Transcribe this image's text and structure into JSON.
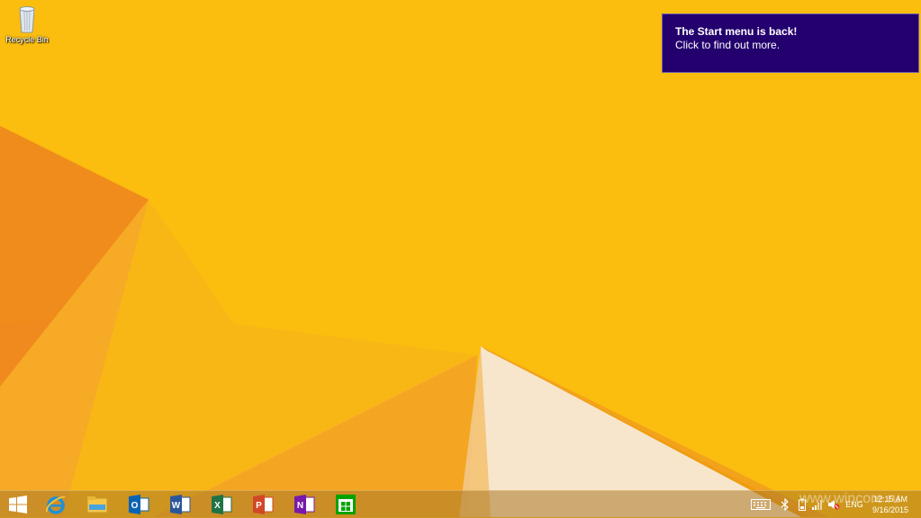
{
  "desktop": {
    "icons": [
      {
        "label": "Recycle Bin",
        "icon": "recycle-bin-icon"
      }
    ]
  },
  "notification": {
    "title": "The Start menu is back!",
    "body": "Click to find out more.",
    "background": "#23006e"
  },
  "taskbar": {
    "start": {
      "icon": "windows-logo-icon"
    },
    "pinned": [
      {
        "name": "Internet Explorer",
        "icon": "internet-explorer-icon",
        "color": "#1e90d6"
      },
      {
        "name": "File Explorer",
        "icon": "file-explorer-icon",
        "color": "#f4c64a"
      },
      {
        "name": "Outlook",
        "icon": "outlook-icon",
        "color": "#0a64b4",
        "letter": "O"
      },
      {
        "name": "Word",
        "icon": "word-icon",
        "color": "#2b579a",
        "letter": "W"
      },
      {
        "name": "Excel",
        "icon": "excel-icon",
        "color": "#217346",
        "letter": "X"
      },
      {
        "name": "PowerPoint",
        "icon": "powerpoint-icon",
        "color": "#d24726",
        "letter": "P"
      },
      {
        "name": "OneNote",
        "icon": "onenote-icon",
        "color": "#7719aa",
        "letter": "N"
      },
      {
        "name": "Store",
        "icon": "store-icon",
        "color": "#00a300"
      }
    ],
    "tray": {
      "icons": [
        "keyboard-icon",
        "bluetooth-icon",
        "battery-icon",
        "signal-icon",
        "volume-muted-icon"
      ],
      "language": "ENG",
      "time": "12:15 AM",
      "date": "9/16/2015"
    }
  },
  "watermark": "www.wincore.ru",
  "colors": {
    "wallpaper": "#fbbd0e",
    "wallpaper_orange": "#f08a1e",
    "wallpaper_cream": "#f7e6cc"
  }
}
